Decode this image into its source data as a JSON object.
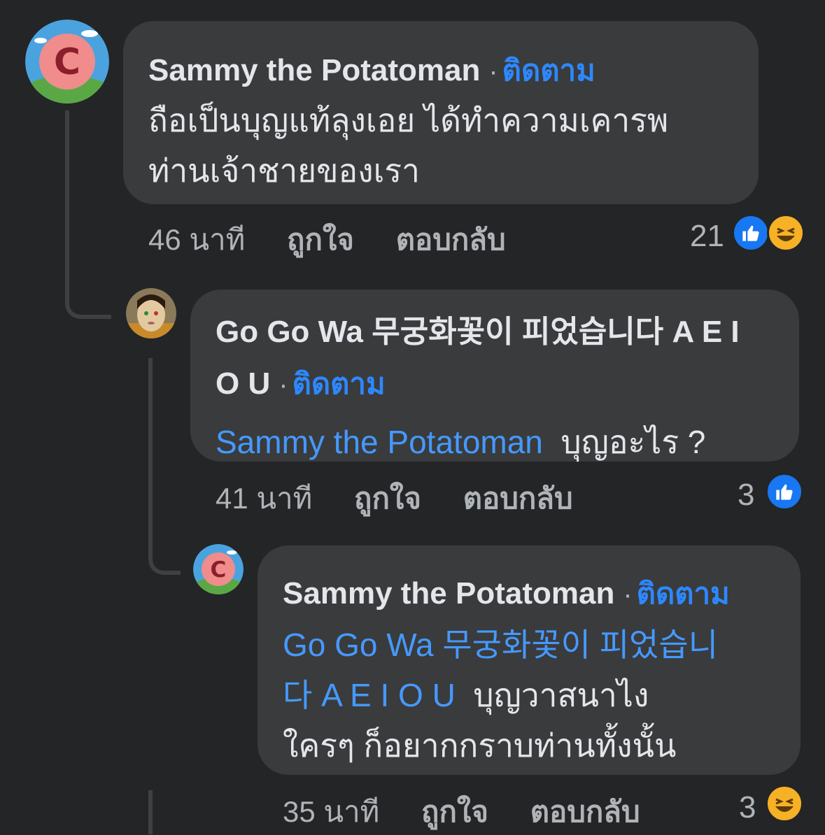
{
  "comments": [
    {
      "author": "Sammy the Potatoman",
      "follow": "ติดตาม",
      "text_line1": "ถือเป็นบุญแท้ลุงเอย ได้ทำความเคารพ",
      "text_line2": "ท่านเจ้าชายของเรา",
      "time": "46 นาที",
      "like": "ถูกใจ",
      "reply": "ตอบกลับ",
      "reaction_count": "21",
      "reactions": [
        "like-icon",
        "haha-icon"
      ]
    },
    {
      "author_line1": "Go Go Wa 무궁화꽃이 피었습니다 A E I",
      "author_line2": "O U",
      "follow": "ติดตาม",
      "mention": "Sammy the Potatoman",
      "text": "บุญอะไร ?",
      "time": "41 นาที",
      "like": "ถูกใจ",
      "reply": "ตอบกลับ",
      "reaction_count": "3",
      "reactions": [
        "like-icon"
      ]
    },
    {
      "author": "Sammy the Potatoman",
      "follow": "ติดตาม",
      "mention_line1": "Go Go Wa 무궁화꽃이 피었습니",
      "mention_line2": "다 A E I O U",
      "text_line2": "บุญวาสนาไง",
      "text_line3": "ใครๆ ก็อยากกราบท่านทั้งนั้น",
      "time": "35 นาที",
      "like": "ถูกใจ",
      "reply": "ตอบกลับ",
      "reaction_count": "3",
      "reactions": [
        "haha-icon"
      ]
    }
  ],
  "separator": "·",
  "colors": {
    "background": "#242526",
    "bubble": "#3a3b3c",
    "link": "#2d88ff",
    "text": "#e4e6eb",
    "muted": "#b0b3b8"
  }
}
